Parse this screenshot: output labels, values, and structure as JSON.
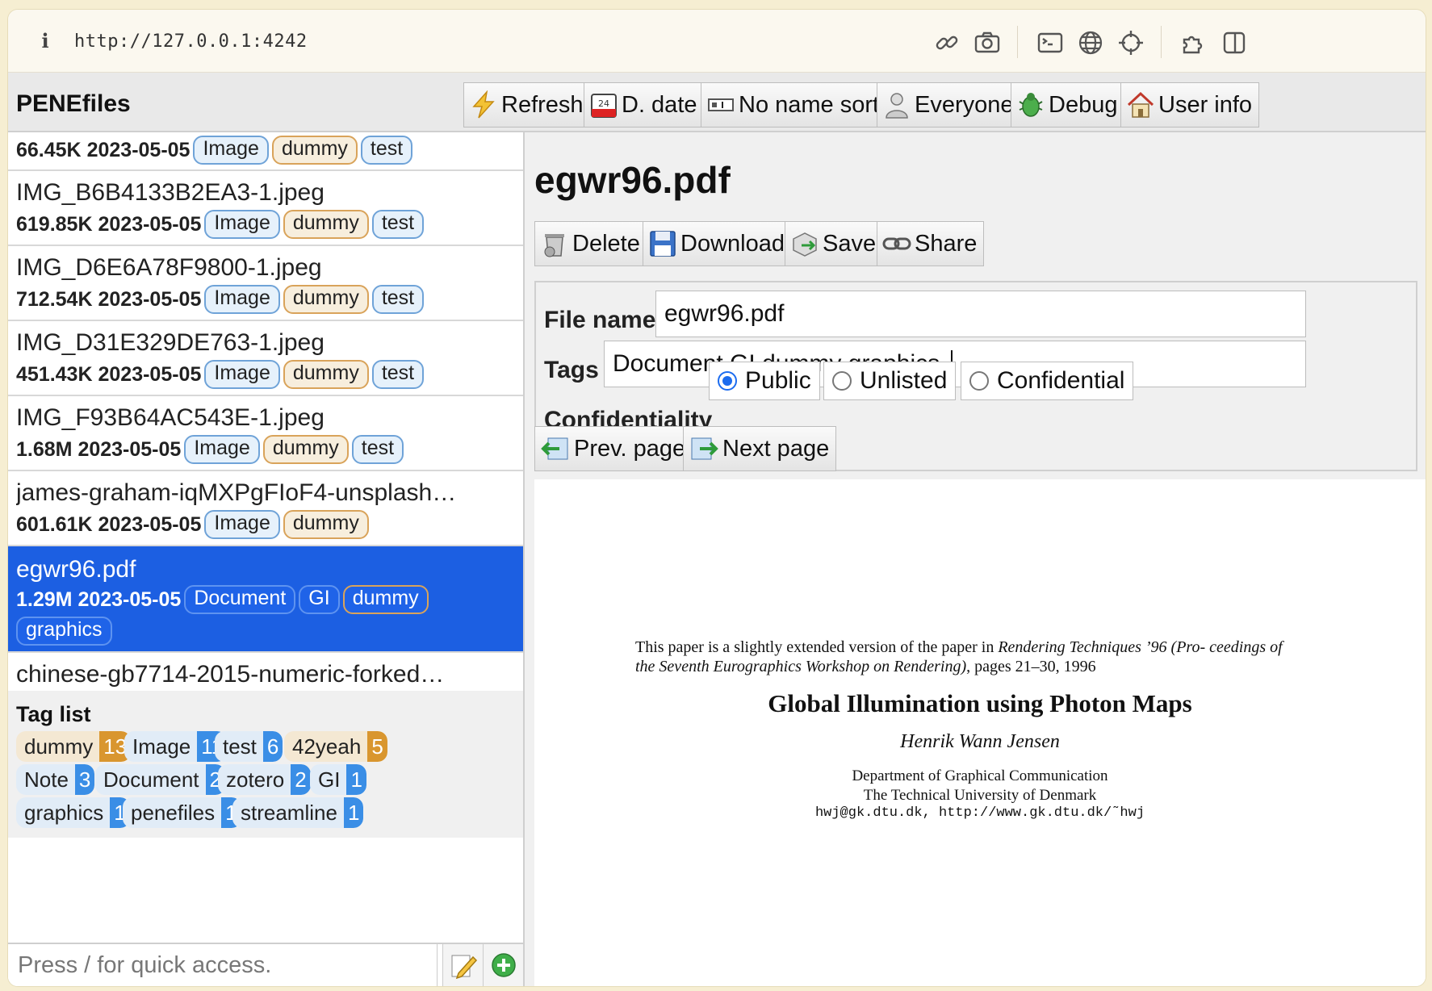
{
  "browser": {
    "url": "http://127.0.0.1:4242"
  },
  "app": {
    "title": "PENEfiles",
    "toolbar": {
      "refresh": "Refresh",
      "date_sort": "D. date",
      "name_sort": "No name sort",
      "everyone": "Everyone",
      "debug": "Debug",
      "user_info": "User info"
    }
  },
  "file_list": [
    {
      "name": "",
      "size": "66.45K",
      "date": "2023-05-05",
      "tags": [
        {
          "label": "Image",
          "color": "blue"
        },
        {
          "label": "dummy",
          "color": "orange"
        },
        {
          "label": "test",
          "color": "blue"
        }
      ]
    },
    {
      "name": "IMG_B6B4133B2EA3-1.jpeg",
      "size": "619.85K",
      "date": "2023-05-05",
      "tags": [
        {
          "label": "Image",
          "color": "blue"
        },
        {
          "label": "dummy",
          "color": "orange"
        },
        {
          "label": "test",
          "color": "blue"
        }
      ]
    },
    {
      "name": "IMG_D6E6A78F9800-1.jpeg",
      "size": "712.54K",
      "date": "2023-05-05",
      "tags": [
        {
          "label": "Image",
          "color": "blue"
        },
        {
          "label": "dummy",
          "color": "orange"
        },
        {
          "label": "test",
          "color": "blue"
        }
      ]
    },
    {
      "name": "IMG_D31E329DE763-1.jpeg",
      "size": "451.43K",
      "date": "2023-05-05",
      "tags": [
        {
          "label": "Image",
          "color": "blue"
        },
        {
          "label": "dummy",
          "color": "orange"
        },
        {
          "label": "test",
          "color": "blue"
        }
      ]
    },
    {
      "name": "IMG_F93B64AC543E-1.jpeg",
      "size": "1.68M",
      "date": "2023-05-05",
      "tags": [
        {
          "label": "Image",
          "color": "blue"
        },
        {
          "label": "dummy",
          "color": "orange"
        },
        {
          "label": "test",
          "color": "blue"
        }
      ]
    },
    {
      "name": "james-graham-iqMXPgFIoF4-unsplash…",
      "size": "601.61K",
      "date": "2023-05-05",
      "tags": [
        {
          "label": "Image",
          "color": "blue"
        },
        {
          "label": "dummy",
          "color": "orange"
        }
      ]
    },
    {
      "name": "egwr96.pdf",
      "size": "1.29M",
      "date": "2023-05-05",
      "selected": true,
      "tags": [
        {
          "label": "Document",
          "color": "blue"
        },
        {
          "label": "GI",
          "color": "blue"
        },
        {
          "label": "dummy",
          "color": "orange"
        },
        {
          "label": "graphics",
          "color": "blue"
        }
      ]
    },
    {
      "name": "chinese-gb7714-2015-numeric-forked…",
      "size": "",
      "date": "",
      "tags": []
    }
  ],
  "tag_list": {
    "title": "Tag list",
    "tags": [
      {
        "label": "dummy",
        "count": "13",
        "color": "orange"
      },
      {
        "label": "Image",
        "count": "11",
        "color": "blue"
      },
      {
        "label": "test",
        "count": "6",
        "color": "blue"
      },
      {
        "label": "42yeah",
        "count": "5",
        "color": "orange"
      },
      {
        "label": "Note",
        "count": "3",
        "color": "blue"
      },
      {
        "label": "Document",
        "count": "2",
        "color": "blue"
      },
      {
        "label": "zotero",
        "count": "2",
        "color": "blue"
      },
      {
        "label": "GI",
        "count": "1",
        "color": "blue"
      },
      {
        "label": "graphics",
        "count": "1",
        "color": "blue"
      },
      {
        "label": "penefiles",
        "count": "1",
        "color": "blue"
      },
      {
        "label": "streamline",
        "count": "1",
        "color": "blue"
      }
    ]
  },
  "quick_access": {
    "placeholder": "Press / for quick access."
  },
  "detail": {
    "title": "egwr96.pdf",
    "actions": {
      "delete": "Delete",
      "download": "Download",
      "save": "Save",
      "share": "Share"
    },
    "form": {
      "file_name_label": "File name",
      "file_name_value": "egwr96.pdf",
      "tags_label": "Tags",
      "tags_value": "Document GI dummy graphics ",
      "confidentiality_label": "Confidentiality",
      "options": [
        "Public",
        "Unlisted",
        "Confidential"
      ],
      "selected_option": "Public"
    },
    "pager": {
      "prev": "Prev. page",
      "next": "Next page"
    },
    "pdf_page": {
      "note_prefix": "This paper is a slightly extended version of the paper in ",
      "note_italic": "Rendering Techniques ’96 (Pro- ceedings of the Seventh Eurographics Workshop on Rendering)",
      "note_suffix": ", pages 21–30, 1996",
      "title": "Global Illumination using Photon Maps",
      "author": "Henrik Wann Jensen",
      "affiliation_1": "Department of Graphical Communication",
      "affiliation_2": "The Technical University of Denmark",
      "contact": "hwj@gk.dtu.dk,   http://www.gk.dtu.dk/˜hwj"
    }
  },
  "colors": {
    "selected_row": "#1c5fe2",
    "tag_blue_border": "#6fa3d8",
    "tag_orange_border": "#d9a35a",
    "count_orange": "#d9962f",
    "count_blue": "#3a8ee6",
    "radio_accent": "#1c6cef"
  }
}
